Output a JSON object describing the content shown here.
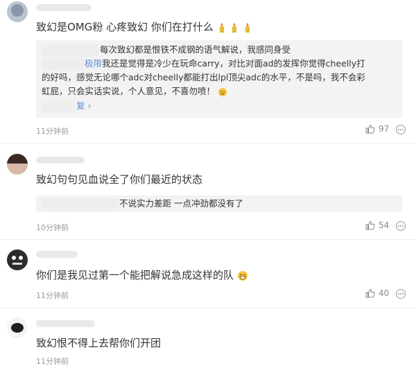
{
  "comments": [
    {
      "text": "致幻是OMG粉 心疼致幻 你们在打什么",
      "emojis": [
        "candle-emoji",
        "candle-emoji",
        "candle-emoji"
      ],
      "reply": {
        "line1": "每次致幻都是恨铁不成钢的语气解说，我感同身受",
        "name_visible": "极限",
        "line2": "我还是觉得是冷少在玩命carry，对比对面ad的发挥你觉得cheelly打",
        "line3": "的好吗，感觉无论哪个adc对cheelly都能打出lpl顶尖adc的水平，不是吗，我不会彩",
        "line4": "虹屁，只会实话实说，个人意见，不喜勿喷！",
        "more_link": "复 ›"
      },
      "time": "11分钟前",
      "likes": "97"
    },
    {
      "text": "致幻句句见血说全了你们最近的状态",
      "reply": {
        "line1": "不说实力差距 一点冲劲都没有了"
      },
      "time": "10分钟前",
      "likes": "54"
    },
    {
      "text": "你们是我见过第一个能把解说急成这样的队",
      "time": "11分钟前",
      "likes": "40"
    },
    {
      "text": "致幻恨不得上去帮你们开团",
      "time": "11分钟前"
    }
  ],
  "colors": {
    "link": "#5b8fcf",
    "time": "#9a9a9a",
    "quote_bg": "#f3f3f3",
    "text": "#333333"
  }
}
